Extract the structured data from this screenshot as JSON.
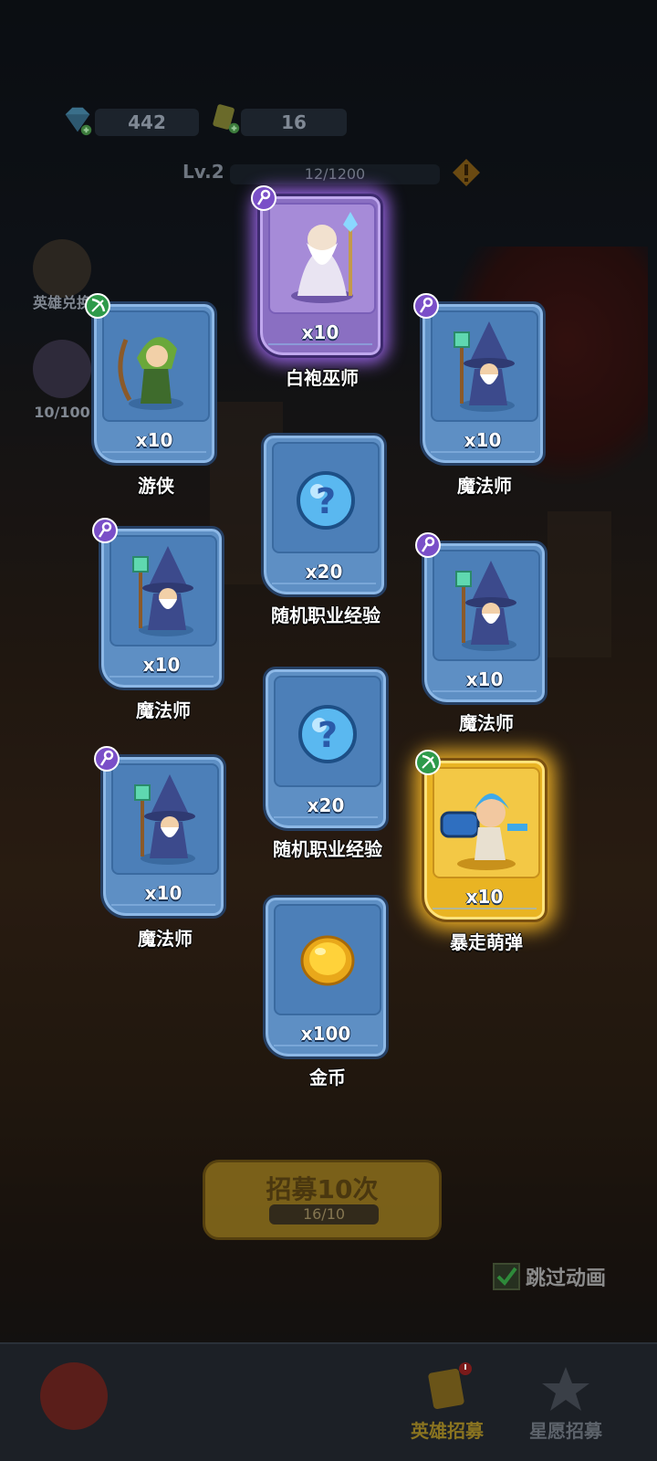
{
  "resources": {
    "gems": "442",
    "tickets": "16"
  },
  "level": {
    "label": "Lv.2",
    "progress_text": "12/1200",
    "progress": 0.01
  },
  "side_menu": {
    "hero_exchange": "英雄兑换",
    "star_progress": "10/100"
  },
  "cards": [
    {
      "id": "white-robe-wizard",
      "name": "白袍巫师",
      "qty": "x10",
      "rarity": "purple",
      "badge": "staff-class-icon"
    },
    {
      "id": "ranger",
      "name": "游侠",
      "qty": "x10",
      "rarity": "blue",
      "badge": "bow-class-icon"
    },
    {
      "id": "mage-1",
      "name": "魔法师",
      "qty": "x10",
      "rarity": "blue",
      "badge": "staff-class-icon"
    },
    {
      "id": "random-exp-1",
      "name": "随机职业经验",
      "qty": "x20",
      "rarity": "blue",
      "badge": ""
    },
    {
      "id": "mage-2",
      "name": "魔法师",
      "qty": "x10",
      "rarity": "blue",
      "badge": "staff-class-icon"
    },
    {
      "id": "mage-3",
      "name": "魔法师",
      "qty": "x10",
      "rarity": "blue",
      "badge": "staff-class-icon"
    },
    {
      "id": "random-exp-2",
      "name": "随机职业经验",
      "qty": "x20",
      "rarity": "blue",
      "badge": ""
    },
    {
      "id": "mage-4",
      "name": "魔法师",
      "qty": "x10",
      "rarity": "blue",
      "badge": "staff-class-icon"
    },
    {
      "id": "rampage-bomber",
      "name": "暴走萌弹",
      "qty": "x10",
      "rarity": "gold",
      "badge": "bow-class-icon"
    },
    {
      "id": "gold-coin",
      "name": "金币",
      "qty": "x100",
      "rarity": "blue",
      "badge": ""
    }
  ],
  "recruit": {
    "label": "招募10次",
    "count": "16/10"
  },
  "skip_animation": {
    "label": "跳过动画",
    "checked": true
  },
  "bottom_tabs": {
    "hero_recruit": "英雄招募",
    "star_wish_recruit": "星愿招募"
  },
  "colors": {
    "blue_card": "#5e8fc4",
    "purple_card": "#8a6fc2",
    "gold_card": "#e9b423"
  }
}
